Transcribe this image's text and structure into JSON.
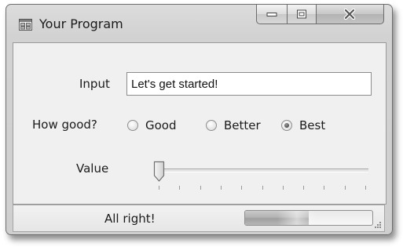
{
  "window": {
    "title": "Your Program"
  },
  "form": {
    "input_label": "Input",
    "input_value": "Let's get started!",
    "rating_label": "How good?",
    "options": [
      "Good",
      "Better",
      "Best"
    ],
    "selected_option": "Best",
    "value_label": "Value",
    "slider_value": 0,
    "slider_ticks": 11
  },
  "status": {
    "text": "All right!",
    "progress_fraction": 0.5
  },
  "icons": {
    "app": "application-window-icon",
    "minimize": "minimize-icon",
    "maximize": "maximize-icon",
    "close": "close-icon",
    "grip": "resize-grip-icon"
  }
}
